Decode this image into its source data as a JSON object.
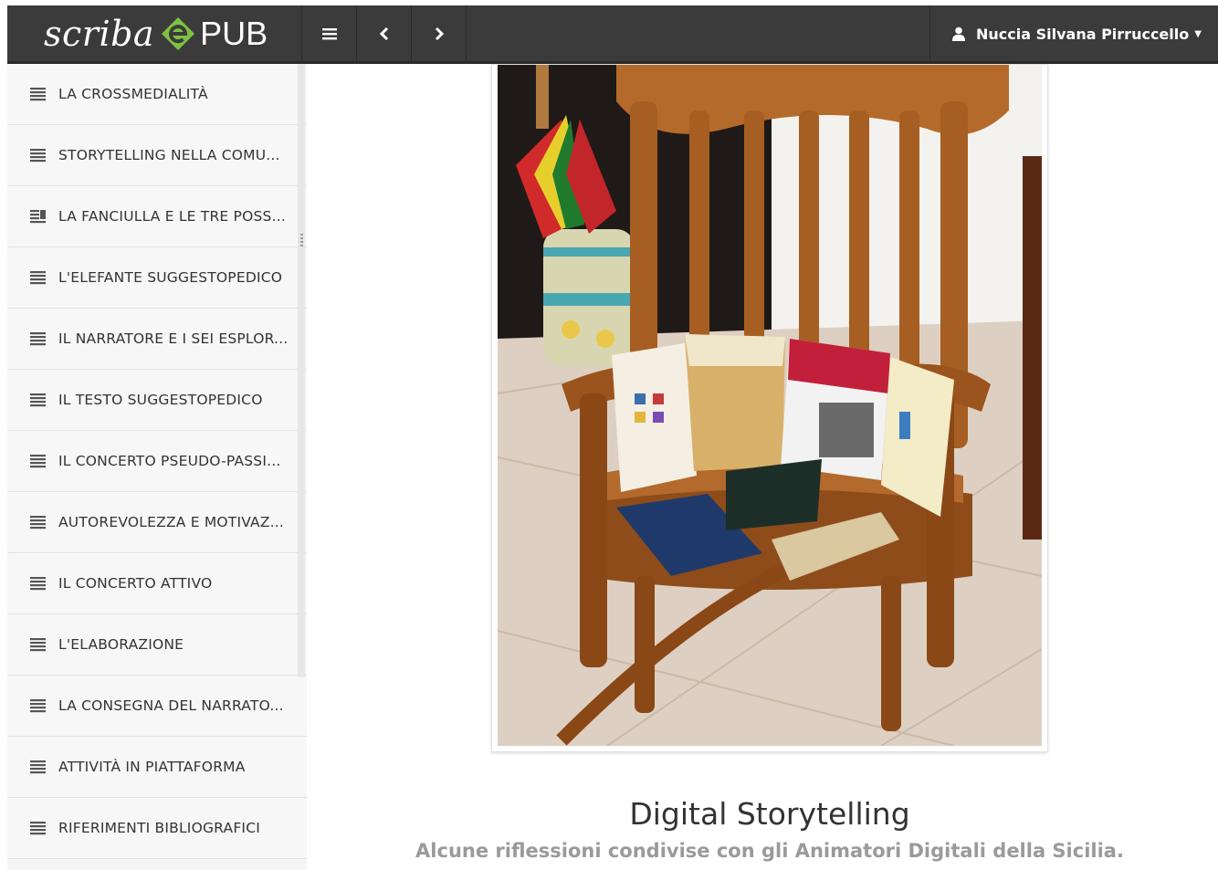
{
  "app": {
    "logo_script": "scriba",
    "logo_suffix": "PUB",
    "accent_color": "#7dc242"
  },
  "toolbar": {
    "menu_icon": "hamburger-icon",
    "prev_icon": "chevron-left-icon",
    "next_icon": "chevron-right-icon"
  },
  "user": {
    "name": "Nuccia Silvana Pirruccello",
    "icon": "user-icon"
  },
  "sidebar": {
    "items": [
      {
        "label": "LA CROSSMEDIALITÀ",
        "icon": "text-lines-icon"
      },
      {
        "label": "STORYTELLING NELLA COMU...",
        "icon": "text-lines-icon"
      },
      {
        "label": "LA FANCIULLA E LE TRE POSS...",
        "icon": "text-image-icon"
      },
      {
        "label": "L'ELEFANTE SUGGESTOPEDICO",
        "icon": "text-lines-icon"
      },
      {
        "label": "IL NARRATORE E I SEI ESPLOR...",
        "icon": "text-lines-icon"
      },
      {
        "label": "IL TESTO SUGGESTOPEDICO",
        "icon": "text-lines-icon"
      },
      {
        "label": "IL CONCERTO PSEUDO-PASSI...",
        "icon": "text-lines-icon"
      },
      {
        "label": "AUTOREVOLEZZA E MOTIVAZ...",
        "icon": "text-lines-icon"
      },
      {
        "label": "IL CONCERTO ATTIVO",
        "icon": "text-lines-icon"
      },
      {
        "label": "L'ELABORAZIONE",
        "icon": "text-lines-icon"
      },
      {
        "label": "LA CONSEGNA DEL NARRATO...",
        "icon": "text-lines-icon"
      },
      {
        "label": "ATTIVITÀ IN PIATTAFORMA",
        "icon": "text-lines-icon"
      },
      {
        "label": "RIFERIMENTI BIBLIOGRAFICI",
        "icon": "text-lines-icon"
      }
    ]
  },
  "main": {
    "cover_image": "rocking-chair-books-photo",
    "title": "Digital Storytelling",
    "subtitle": "Alcune riflessioni condivise con gli Animatori Digitali della Sicilia."
  }
}
